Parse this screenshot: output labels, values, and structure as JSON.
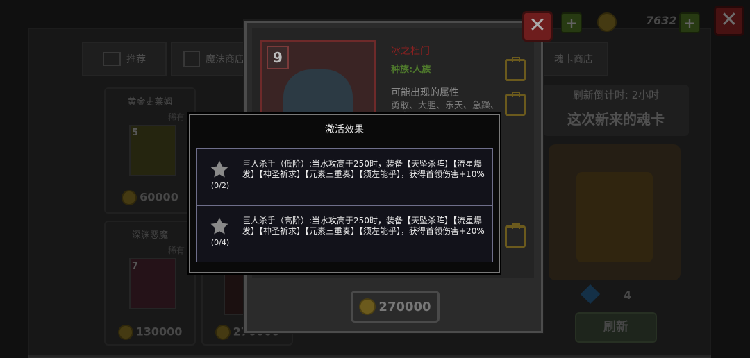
{
  "shop": {
    "tabs": [
      {
        "label": "推荐"
      },
      {
        "label": "魔法商店"
      },
      {
        "label": "魂卡商店"
      }
    ],
    "cards": [
      {
        "name": "黄金史莱姆",
        "tag": "稀有",
        "level": "5",
        "price": "60000"
      },
      {
        "name": "深渊恶魔",
        "tag": "稀有",
        "level": "7",
        "price": "130000"
      },
      {
        "name": "",
        "price": "270000"
      }
    ]
  },
  "topbar": {
    "gold": "7632"
  },
  "detail": {
    "level": "9",
    "name": "冰之杜门",
    "race": "种族:人族",
    "attr_title": "可能出现的属性",
    "attrs": "勇敢、大胆、乐天、急躁、顽皮、淘气",
    "price": "270000"
  },
  "right_panel": {
    "refresh_timer": "刷新倒计时: 2小时",
    "refresh_sub": "这次新来的魂卡",
    "gem_count": "4",
    "refresh_button": "刷新"
  },
  "modal": {
    "title": "激活效果",
    "effects": [
      {
        "progress": "(0/2)",
        "text": "巨人杀手（低阶）:当水攻高于250时，装备【天坠杀阵】【流星爆发】【神圣祈求】【元素三重奏】【须左能乎】，获得首领伤害+10%"
      },
      {
        "progress": "(0/4)",
        "text": "巨人杀手（高阶）:当水攻高于250时，装备【天坠杀阵】【流星爆发】【神圣祈求】【元素三重奏】【须左能乎】，获得首领伤害+20%"
      }
    ]
  },
  "colors": {
    "modal_bg": "#0a0a0a",
    "modal_border": "#7a7a7a",
    "close_red": "#6e1d1d",
    "plus_green": "#3d5a1c"
  }
}
